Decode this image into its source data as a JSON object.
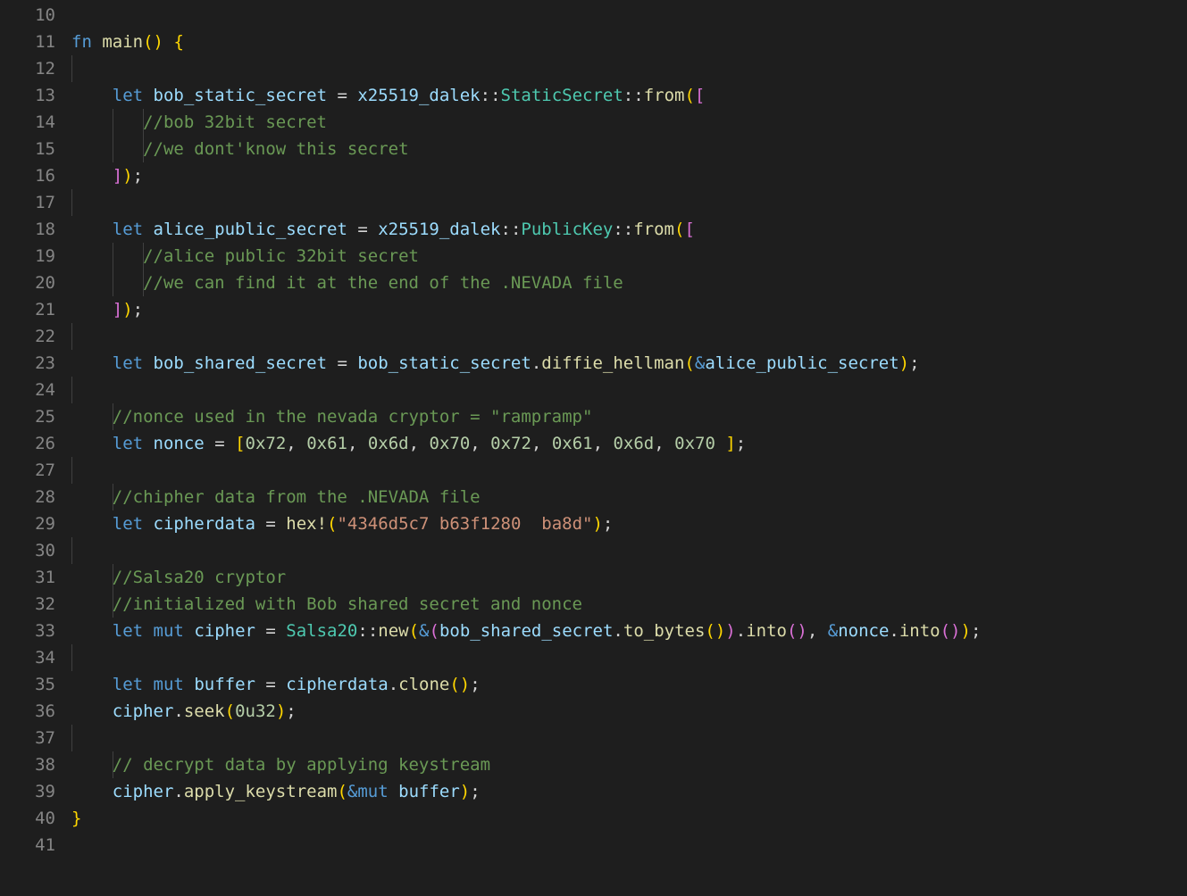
{
  "first_line_number": 10,
  "last_line_number": 41,
  "lines": {
    "10": [],
    "11": [
      {
        "cls": "kw",
        "t": "fn "
      },
      {
        "cls": "fnname",
        "t": "main"
      },
      {
        "cls": "brace2",
        "t": "()"
      },
      {
        "cls": "punct",
        "t": " "
      },
      {
        "cls": "brace2",
        "t": "{"
      }
    ],
    "12": [
      {
        "guide": 1
      }
    ],
    "13": [
      {
        "cls": "punct",
        "t": "    "
      },
      {
        "cls": "kw",
        "t": "let"
      },
      {
        "cls": "punct",
        "t": " "
      },
      {
        "cls": "var",
        "t": "bob_static_secret"
      },
      {
        "cls": "punct",
        "t": " = "
      },
      {
        "cls": "mod",
        "t": "x25519_dalek"
      },
      {
        "cls": "punct",
        "t": "::"
      },
      {
        "cls": "type",
        "t": "StaticSecret"
      },
      {
        "cls": "punct",
        "t": "::"
      },
      {
        "cls": "fnname",
        "t": "from"
      },
      {
        "cls": "brace2",
        "t": "("
      },
      {
        "cls": "brace",
        "t": "["
      }
    ],
    "14": [
      {
        "cls": "punct",
        "t": "    "
      },
      {
        "guide": 1
      },
      {
        "cls": "punct",
        "t": "   "
      },
      {
        "guide": 1
      },
      {
        "cls": "cmt",
        "t": "//bob 32bit secret"
      }
    ],
    "15": [
      {
        "cls": "punct",
        "t": "    "
      },
      {
        "guide": 1
      },
      {
        "cls": "punct",
        "t": "   "
      },
      {
        "guide": 1
      },
      {
        "cls": "cmt",
        "t": "//we dont'know this secret"
      }
    ],
    "16": [
      {
        "cls": "punct",
        "t": "    "
      },
      {
        "cls": "brace",
        "t": "]"
      },
      {
        "cls": "brace2",
        "t": ")"
      },
      {
        "cls": "punct",
        "t": ";"
      }
    ],
    "17": [
      {
        "guide": 1
      }
    ],
    "18": [
      {
        "cls": "punct",
        "t": "    "
      },
      {
        "cls": "kw",
        "t": "let"
      },
      {
        "cls": "punct",
        "t": " "
      },
      {
        "cls": "var",
        "t": "alice_public_secret"
      },
      {
        "cls": "punct",
        "t": " = "
      },
      {
        "cls": "mod",
        "t": "x25519_dalek"
      },
      {
        "cls": "punct",
        "t": "::"
      },
      {
        "cls": "type",
        "t": "PublicKey"
      },
      {
        "cls": "punct",
        "t": "::"
      },
      {
        "cls": "fnname",
        "t": "from"
      },
      {
        "cls": "brace2",
        "t": "("
      },
      {
        "cls": "brace",
        "t": "["
      }
    ],
    "19": [
      {
        "cls": "punct",
        "t": "    "
      },
      {
        "guide": 1
      },
      {
        "cls": "punct",
        "t": "   "
      },
      {
        "guide": 1
      },
      {
        "cls": "cmt",
        "t": "//alice public 32bit secret"
      }
    ],
    "20": [
      {
        "cls": "punct",
        "t": "    "
      },
      {
        "guide": 1
      },
      {
        "cls": "punct",
        "t": "   "
      },
      {
        "guide": 1
      },
      {
        "cls": "cmt",
        "t": "//we can find it at the end of the .NEVADA file"
      }
    ],
    "21": [
      {
        "cls": "punct",
        "t": "    "
      },
      {
        "cls": "brace",
        "t": "]"
      },
      {
        "cls": "brace2",
        "t": ")"
      },
      {
        "cls": "punct",
        "t": ";"
      }
    ],
    "22": [
      {
        "guide": 1
      }
    ],
    "23": [
      {
        "cls": "punct",
        "t": "    "
      },
      {
        "cls": "kw",
        "t": "let"
      },
      {
        "cls": "punct",
        "t": " "
      },
      {
        "cls": "var",
        "t": "bob_shared_secret"
      },
      {
        "cls": "punct",
        "t": " = "
      },
      {
        "cls": "var",
        "t": "bob_static_secret"
      },
      {
        "cls": "punct",
        "t": "."
      },
      {
        "cls": "fnname",
        "t": "diffie_hellman"
      },
      {
        "cls": "brace2",
        "t": "("
      },
      {
        "cls": "amp",
        "t": "&"
      },
      {
        "cls": "var",
        "t": "alice_public_secret"
      },
      {
        "cls": "brace2",
        "t": ")"
      },
      {
        "cls": "punct",
        "t": ";"
      }
    ],
    "24": [
      {
        "guide": 1
      }
    ],
    "25": [
      {
        "cls": "punct",
        "t": "    "
      },
      {
        "guide": 1
      },
      {
        "cls": "cmt",
        "t": "//nonce used in the nevada cryptor = \"rampramp\""
      }
    ],
    "26": [
      {
        "cls": "punct",
        "t": "    "
      },
      {
        "cls": "kw",
        "t": "let"
      },
      {
        "cls": "punct",
        "t": " "
      },
      {
        "cls": "var",
        "t": "nonce"
      },
      {
        "cls": "punct",
        "t": " = "
      },
      {
        "cls": "brace2",
        "t": "["
      },
      {
        "cls": "num",
        "t": "0x72"
      },
      {
        "cls": "punct",
        "t": ", "
      },
      {
        "cls": "num",
        "t": "0x61"
      },
      {
        "cls": "punct",
        "t": ", "
      },
      {
        "cls": "num",
        "t": "0x6d"
      },
      {
        "cls": "punct",
        "t": ", "
      },
      {
        "cls": "num",
        "t": "0x70"
      },
      {
        "cls": "punct",
        "t": ", "
      },
      {
        "cls": "num",
        "t": "0x72"
      },
      {
        "cls": "punct",
        "t": ", "
      },
      {
        "cls": "num",
        "t": "0x61"
      },
      {
        "cls": "punct",
        "t": ", "
      },
      {
        "cls": "num",
        "t": "0x6d"
      },
      {
        "cls": "punct",
        "t": ", "
      },
      {
        "cls": "num",
        "t": "0x70"
      },
      {
        "cls": "punct",
        "t": " "
      },
      {
        "cls": "brace2",
        "t": "]"
      },
      {
        "cls": "punct",
        "t": ";"
      }
    ],
    "27": [
      {
        "guide": 1
      }
    ],
    "28": [
      {
        "cls": "punct",
        "t": "    "
      },
      {
        "guide": 1
      },
      {
        "cls": "cmt",
        "t": "//chipher data from the .NEVADA file"
      }
    ],
    "29": [
      {
        "cls": "punct",
        "t": "    "
      },
      {
        "cls": "kw",
        "t": "let"
      },
      {
        "cls": "punct",
        "t": " "
      },
      {
        "cls": "var",
        "t": "cipherdata"
      },
      {
        "cls": "punct",
        "t": " = "
      },
      {
        "cls": "macro",
        "t": "hex!"
      },
      {
        "cls": "brace2",
        "t": "("
      },
      {
        "cls": "str",
        "t": "\"4346d5c7 b63f1280  ba8d\""
      },
      {
        "cls": "brace2",
        "t": ")"
      },
      {
        "cls": "punct",
        "t": ";"
      }
    ],
    "30": [
      {
        "guide": 1
      }
    ],
    "31": [
      {
        "cls": "punct",
        "t": "    "
      },
      {
        "guide": 1
      },
      {
        "cls": "cmt",
        "t": "//Salsa20 cryptor"
      }
    ],
    "32": [
      {
        "cls": "punct",
        "t": "    "
      },
      {
        "guide": 1
      },
      {
        "cls": "cmt",
        "t": "//initialized with Bob shared secret and nonce"
      }
    ],
    "33": [
      {
        "cls": "punct",
        "t": "    "
      },
      {
        "cls": "kw",
        "t": "let"
      },
      {
        "cls": "punct",
        "t": " "
      },
      {
        "cls": "kw",
        "t": "mut"
      },
      {
        "cls": "punct",
        "t": " "
      },
      {
        "cls": "var",
        "t": "cipher"
      },
      {
        "cls": "punct",
        "t": " = "
      },
      {
        "cls": "type",
        "t": "Salsa20"
      },
      {
        "cls": "punct",
        "t": "::"
      },
      {
        "cls": "fnname",
        "t": "new"
      },
      {
        "cls": "brace2",
        "t": "("
      },
      {
        "cls": "amp",
        "t": "&"
      },
      {
        "cls": "brace",
        "t": "("
      },
      {
        "cls": "var",
        "t": "bob_shared_secret"
      },
      {
        "cls": "punct",
        "t": "."
      },
      {
        "cls": "fnname",
        "t": "to_bytes"
      },
      {
        "cls": "brace2",
        "t": "()"
      },
      {
        "cls": "brace",
        "t": ")"
      },
      {
        "cls": "punct",
        "t": "."
      },
      {
        "cls": "fnname",
        "t": "into"
      },
      {
        "cls": "brace",
        "t": "()"
      },
      {
        "cls": "punct",
        "t": ", "
      },
      {
        "cls": "amp",
        "t": "&"
      },
      {
        "cls": "var",
        "t": "nonce"
      },
      {
        "cls": "punct",
        "t": "."
      },
      {
        "cls": "fnname",
        "t": "into"
      },
      {
        "cls": "brace",
        "t": "()"
      },
      {
        "cls": "brace2",
        "t": ")"
      },
      {
        "cls": "punct",
        "t": ";"
      }
    ],
    "34": [
      {
        "guide": 1
      }
    ],
    "35": [
      {
        "cls": "punct",
        "t": "    "
      },
      {
        "cls": "kw",
        "t": "let"
      },
      {
        "cls": "punct",
        "t": " "
      },
      {
        "cls": "kw",
        "t": "mut"
      },
      {
        "cls": "punct",
        "t": " "
      },
      {
        "cls": "var",
        "t": "buffer"
      },
      {
        "cls": "punct",
        "t": " = "
      },
      {
        "cls": "var",
        "t": "cipherdata"
      },
      {
        "cls": "punct",
        "t": "."
      },
      {
        "cls": "fnname",
        "t": "clone"
      },
      {
        "cls": "brace2",
        "t": "()"
      },
      {
        "cls": "punct",
        "t": ";"
      }
    ],
    "36": [
      {
        "cls": "punct",
        "t": "    "
      },
      {
        "cls": "var",
        "t": "cipher"
      },
      {
        "cls": "punct",
        "t": "."
      },
      {
        "cls": "fnname",
        "t": "seek"
      },
      {
        "cls": "brace2",
        "t": "("
      },
      {
        "cls": "num",
        "t": "0u32"
      },
      {
        "cls": "brace2",
        "t": ")"
      },
      {
        "cls": "punct",
        "t": ";"
      }
    ],
    "37": [
      {
        "guide": 1
      }
    ],
    "38": [
      {
        "cls": "punct",
        "t": "    "
      },
      {
        "guide": 1
      },
      {
        "cls": "cmt",
        "t": "// decrypt data by applying keystream"
      }
    ],
    "39": [
      {
        "cls": "punct",
        "t": "    "
      },
      {
        "cls": "var",
        "t": "cipher"
      },
      {
        "cls": "punct",
        "t": "."
      },
      {
        "cls": "fnname",
        "t": "apply_keystream"
      },
      {
        "cls": "brace2",
        "t": "("
      },
      {
        "cls": "amp",
        "t": "&"
      },
      {
        "cls": "kw",
        "t": "mut"
      },
      {
        "cls": "punct",
        "t": " "
      },
      {
        "cls": "var",
        "t": "buffer"
      },
      {
        "cls": "brace2",
        "t": ")"
      },
      {
        "cls": "punct",
        "t": ";"
      }
    ],
    "40": [
      {
        "cls": "brace2",
        "t": "}"
      }
    ],
    "41": []
  }
}
